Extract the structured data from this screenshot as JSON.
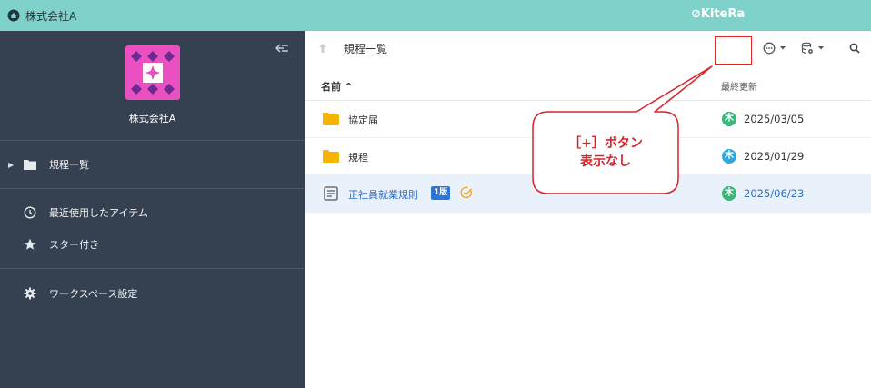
{
  "topbar": {
    "company": "株式会社A",
    "brand": "⊘KiteRa"
  },
  "sidebar": {
    "company": "株式会社A",
    "items": [
      {
        "label": "規程一覧",
        "icon": "folder-icon"
      },
      {
        "label": "最近使用したアイテム",
        "icon": "clock-icon"
      },
      {
        "label": "スター付き",
        "icon": "star-icon"
      },
      {
        "label": "ワークスペース設定",
        "icon": "gear-icon"
      }
    ]
  },
  "main": {
    "title": "規程一覧",
    "columns": {
      "name": "名前 ^",
      "updated": "最終更新"
    },
    "rows": [
      {
        "name": "協定届",
        "type": "folder",
        "date": "2025/03/05",
        "avatar": "木",
        "avatar_color": "#3bb57a"
      },
      {
        "name": "規程",
        "type": "folder",
        "date": "2025/01/29",
        "avatar": "木",
        "avatar_color": "#2fa8e0"
      },
      {
        "name": "正社員就業規則",
        "type": "document",
        "badge": "1版",
        "date": "2025/06/23",
        "avatar": "木",
        "avatar_color": "#3bb57a"
      }
    ]
  },
  "annotation": {
    "line1": "［+］ボタン",
    "line2": "表示なし",
    "color": "#e02727"
  },
  "colors": {
    "topbar": "#7fd2c9",
    "sidebar": "#354150",
    "accent_blue": "#2e75d6",
    "folder": "#f5b400"
  }
}
